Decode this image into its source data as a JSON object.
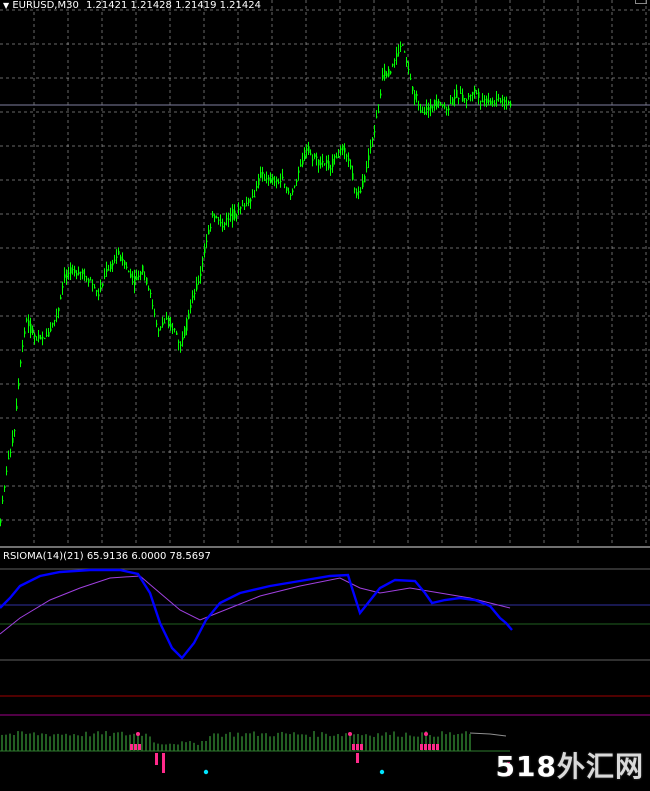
{
  "chart": {
    "symbol_label": "EURUSD,M30",
    "quote": "1.21421 1.21428 1.21419 1.21424",
    "up_color": "#00ff00",
    "grid_color": "#c0c0c0",
    "bid_line_color": "#8080a0"
  },
  "indicator": {
    "label": "RSIOMA(14)(21) 65.9136 6.0000 78.5697",
    "rsioma_color": "#0000ff",
    "signal_color": "#a040e0",
    "upper_level_color": "#606060",
    "mid_level_color": "#3030a0",
    "low_level_color": "#206020",
    "red_level_color": "#a00000",
    "magenta_level_color": "#a0008a",
    "histogram_color": "#2e7d2e",
    "marker_pink": "#ff2a8a",
    "marker_cyan": "#00e5ff"
  },
  "watermark": {
    "number": "518",
    "text": "外汇网",
    "icon": "logo-watermark"
  }
}
